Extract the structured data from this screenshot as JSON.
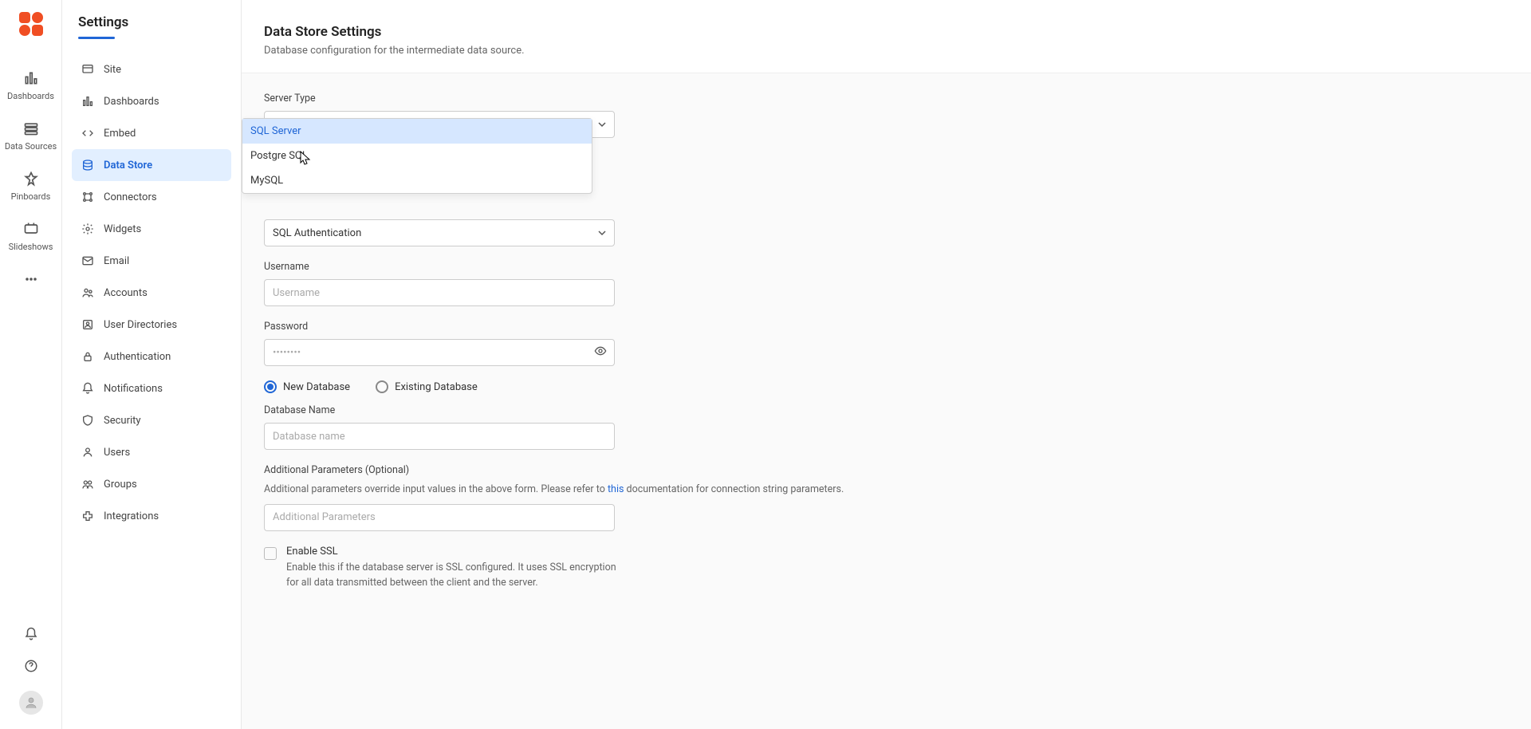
{
  "rail": {
    "items": [
      {
        "label": "Dashboards"
      },
      {
        "label": "Data Sources"
      },
      {
        "label": "Pinboards"
      },
      {
        "label": "Slideshows"
      }
    ]
  },
  "sidenav": {
    "title": "Settings",
    "items": [
      {
        "label": "Site"
      },
      {
        "label": "Dashboards"
      },
      {
        "label": "Embed"
      },
      {
        "label": "Data Store"
      },
      {
        "label": "Connectors"
      },
      {
        "label": "Widgets"
      },
      {
        "label": "Email"
      },
      {
        "label": "Accounts"
      },
      {
        "label": "User Directories"
      },
      {
        "label": "Authentication"
      },
      {
        "label": "Notifications"
      },
      {
        "label": "Security"
      },
      {
        "label": "Users"
      },
      {
        "label": "Groups"
      },
      {
        "label": "Integrations"
      }
    ]
  },
  "page": {
    "title": "Data Store Settings",
    "subtitle": "Database configuration for the intermediate data source."
  },
  "form": {
    "server_type": {
      "label": "Server Type",
      "value": "SQL Server",
      "options": [
        "SQL Server",
        "Postgre SQL",
        "MySQL"
      ]
    },
    "auth": {
      "value": "SQL Authentication"
    },
    "username": {
      "label": "Username",
      "placeholder": "Username"
    },
    "password": {
      "label": "Password",
      "placeholder": "••••••••"
    },
    "db_mode": {
      "new": "New Database",
      "existing": "Existing Database"
    },
    "db_name": {
      "label": "Database Name",
      "placeholder": "Database name"
    },
    "additional": {
      "label": "Additional Parameters (Optional)",
      "help_pre": "Additional parameters override input values in the above form. Please refer to ",
      "help_link": "this",
      "help_post": " documentation for connection string parameters.",
      "placeholder": "Additional Parameters"
    },
    "ssl": {
      "label": "Enable SSL",
      "help": "Enable this if the database server is SSL configured. It uses SSL encryption for all data transmitted between the client and the server."
    }
  }
}
